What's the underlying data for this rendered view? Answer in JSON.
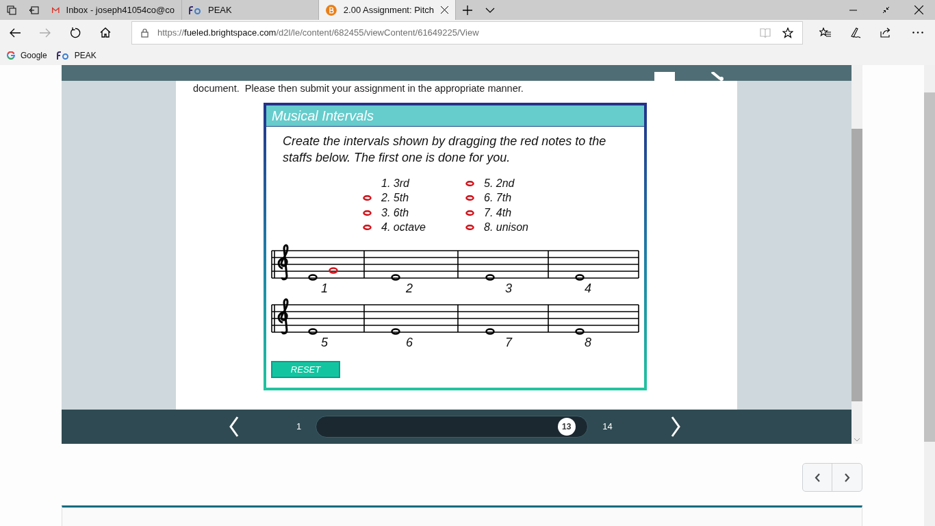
{
  "browser": {
    "tabs": [
      {
        "title": "Inbox - joseph41054co@co",
        "selected": false
      },
      {
        "title": "PEAK",
        "selected": false
      },
      {
        "title": "2.00 Assignment: Pitch",
        "selected": true
      }
    ],
    "url": {
      "scheme": "https://",
      "host": "fueled.brightspace.com",
      "path": "/d2l/le/content/682455/viewContent/61649225/View"
    },
    "favorites": [
      {
        "label": "Google"
      },
      {
        "label": "PEAK"
      }
    ]
  },
  "page": {
    "text": "document.  Please then submit your assignment in the appropriate manner.",
    "activity": {
      "title": "Musical Intervals",
      "instructions": "Create the intervals shown by dragging the red notes to the staffs below. The first one is done for you.",
      "intervals": [
        {
          "label": "1. 3rd",
          "note_available": false
        },
        {
          "label": "2. 5th",
          "note_available": true
        },
        {
          "label": "3. 6th",
          "note_available": true
        },
        {
          "label": "4. octave",
          "note_available": true
        },
        {
          "label": "5. 2nd",
          "note_available": true
        },
        {
          "label": "6. 7th",
          "note_available": true
        },
        {
          "label": "7. 4th",
          "note_available": true
        },
        {
          "label": "8. unison",
          "note_available": true
        }
      ],
      "measures": [
        {
          "number": "1",
          "answered": true
        },
        {
          "number": "2",
          "answered": false
        },
        {
          "number": "3",
          "answered": false
        },
        {
          "number": "4",
          "answered": false
        },
        {
          "number": "5",
          "answered": false
        },
        {
          "number": "6",
          "answered": false
        },
        {
          "number": "7",
          "answered": false
        },
        {
          "number": "8",
          "answered": false
        }
      ],
      "reset": "RESET"
    },
    "pager": {
      "first": "1",
      "current": "13",
      "last": "14",
      "level": 0.923
    }
  }
}
